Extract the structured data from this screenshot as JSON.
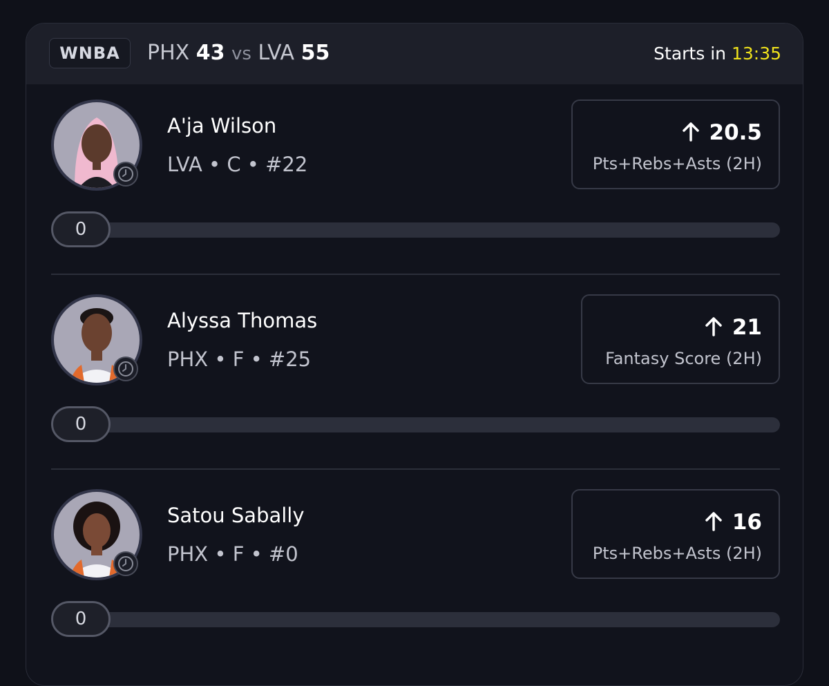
{
  "header": {
    "league": "WNBA",
    "home_team": "PHX",
    "home_score": "43",
    "vs": "vs",
    "away_team": "LVA",
    "away_score": "55",
    "starts_label": "Starts in",
    "starts_time": "13:35"
  },
  "colors": {
    "accent_time": "#f0e21c",
    "card_bg": "#11131c",
    "header_bg": "#1d1f29"
  },
  "players": [
    {
      "name": "A'ja Wilson",
      "meta": "LVA • C • #22",
      "direction_icon": "arrow-up-icon",
      "line": "20.5",
      "stat": "Pts+Rebs+Asts (2H)",
      "progress_value": "0",
      "progress_fraction": 0
    },
    {
      "name": "Alyssa Thomas",
      "meta": "PHX • F • #25",
      "direction_icon": "arrow-up-icon",
      "line": "21",
      "stat": "Fantasy Score (2H)",
      "progress_value": "0",
      "progress_fraction": 0
    },
    {
      "name": "Satou Sabally",
      "meta": "PHX • F • #0",
      "direction_icon": "arrow-up-icon",
      "line": "16",
      "stat": "Pts+Rebs+Asts (2H)",
      "progress_value": "0",
      "progress_fraction": 0
    }
  ]
}
